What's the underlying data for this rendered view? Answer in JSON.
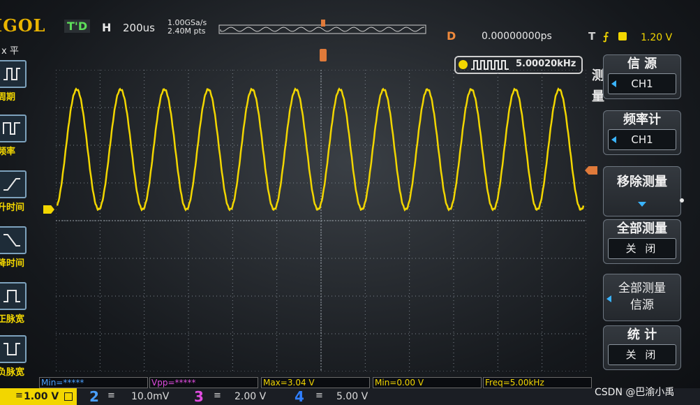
{
  "brand": "IGOL",
  "topbar": {
    "trig_status": "T'D",
    "h_label": "H",
    "timebase": "200us",
    "sample_rate": "1.00GSa/s",
    "mem_depth": "2.40M pts",
    "delay_label": "D",
    "delay_value": "0.00000000ps",
    "trig_label": "T",
    "trig_level": "1.20 V"
  },
  "freq_badge": {
    "value": "5.00020kHz"
  },
  "left_panel": {
    "title": "x 平",
    "items": [
      {
        "label": "周期",
        "icon": "period-icon"
      },
      {
        "label": "频率",
        "icon": "frequency-icon"
      },
      {
        "label": "升时间",
        "icon": "rise-time-icon"
      },
      {
        "label": "降时间",
        "icon": "fall-time-icon"
      },
      {
        "label": "正脉宽",
        "icon": "positive-width-icon"
      },
      {
        "label": "负脉宽",
        "icon": "negative-width-icon"
      }
    ]
  },
  "right_menu": {
    "side_title": "测量",
    "buttons": [
      {
        "title": "信 源",
        "value": "CH1"
      },
      {
        "title": "频率计",
        "value": "CH1"
      },
      {
        "title": "移除测量",
        "value": ""
      },
      {
        "title": "全部测量",
        "value": "关 闭"
      },
      {
        "title": "全部测量",
        "value": "信源"
      },
      {
        "title": "统 计",
        "value": "关 闭"
      }
    ]
  },
  "measurements": [
    {
      "text": "Min=*****",
      "color": "blue"
    },
    {
      "text": "Vpp=*****",
      "color": "magenta"
    },
    {
      "text": "Max=3.04 V",
      "color": "yellow"
    },
    {
      "text": "Min=0.00 V",
      "color": "yellow"
    },
    {
      "text": "Freq=5.00kHz",
      "color": "yellow"
    }
  ],
  "channels": [
    {
      "num": "1",
      "scale": "1.00 V"
    },
    {
      "num": "2",
      "scale": "10.0mV"
    },
    {
      "num": "3",
      "scale": "2.00 V"
    },
    {
      "num": "4",
      "scale": "5.00 V"
    }
  ],
  "waveform": {
    "cycles": 12,
    "color": "#f2d600"
  },
  "watermark": "CSDN @巴渝小禹",
  "colors": {
    "ch1": "#f2d600",
    "trigger": "#e07a3a",
    "ch2": "#4aa0ff",
    "ch3": "#e04ce0",
    "ch4": "#2f7fff"
  }
}
